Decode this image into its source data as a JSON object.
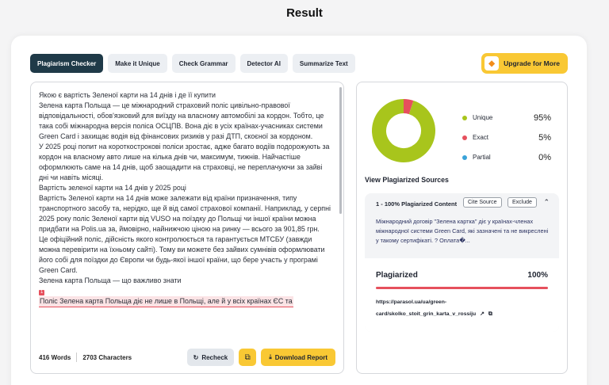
{
  "page_title": "Result",
  "tabs": [
    {
      "label": "Plagiarism Checker"
    },
    {
      "label": "Make it Unique"
    },
    {
      "label": "Check Grammar"
    },
    {
      "label": "Detector AI"
    },
    {
      "label": "Summarize Text"
    }
  ],
  "upgrade": {
    "label": "Upgrade for More",
    "icon": "gem-icon"
  },
  "editor": {
    "lines": [
      "Якою є вартість Зеленої карти на 14 днів і де її купити",
      "Зелена карта Польща — це міжнародний страховий поліс цивільно-правової відповідальності, обов'язковий для виїзду на власному автомобілі за кордон. Тобто, це така собі міжнародна версія поліса ОСЦПВ. Вона діє в усіх країнах-учасниках системи Green Card і захищає водія від фінансових ризиків у разі ДТП, скоєної за кордоном.",
      "У 2025 році попит на короткострокові поліси зростає, адже багато водіїв подорожують за кордон на власному авто лише на кілька днів чи, максимум, тижнів. Найчастіше оформлюють саме на 14 днів, щоб заощадити на страховці, не переплачуючи за зайві дні чи навіть місяці.",
      "Вартість зеленої карти на 14 днів у 2025 році",
      "Вартість Зеленої карти на 14 днів може залежати від країни призначення, типу транспортного засобу та, нерідко, ще й від самої страхової компанії. Наприклад, у серпні 2025 року поліс Зеленої карти від VUSO на поїздку до Польщі чи іншої країни можна придбати на Polis.ua за, ймовірно, найнижчою ціною на ринку — всього за 901,85 грн.",
      "Це офіційний поліс, дійсність якого контролюється та гарантується МТСБУ (завжди можна перевірити на їхньому сайті). Тому ви можете без зайвих сумнівів оформлювати його собі для поїздки до Європи чи будь-якої іншої країни, що бере участь у програмі Green Card.",
      "Зелена карта Польща — що важливо знати"
    ],
    "marker": "1",
    "highlighted": "Поліс Зелена карта Польща діє не лише в Польщі, але й у всіх країнах ЄС та",
    "words": "416 Words",
    "characters": "2703 Characters",
    "recheck_label": "Recheck",
    "download_label": "Download Report"
  },
  "result": {
    "legend": [
      {
        "label": "Unique",
        "pct": "95%",
        "value": 95,
        "color": "#a8c51c"
      },
      {
        "label": "Exact",
        "pct": "5%",
        "value": 5,
        "color": "#e6505d"
      },
      {
        "label": "Partial",
        "pct": "0%",
        "value": 0,
        "color": "#3aa3d9"
      }
    ],
    "sources_title": "View Plagiarized Sources",
    "source": {
      "heading": "1 - 100% Plagiarized Content",
      "cite_label": "Cite Source",
      "exclude_label": "Exclude",
      "snippet": "Міжнародний договір \"Зелена картка\" діє у країнах-членах міжнародної системи Green Card, які зазначені та не викреслені у такому сертифікаті. ? Оплата�...",
      "plag_label": "Plagiarized",
      "plag_pct": "100%",
      "plag_value": 100,
      "url_line1": "https://parasol.ua/ua/green-",
      "url_line2": "card/skolko_stoit_grin_karta_v_rossiju"
    }
  }
}
